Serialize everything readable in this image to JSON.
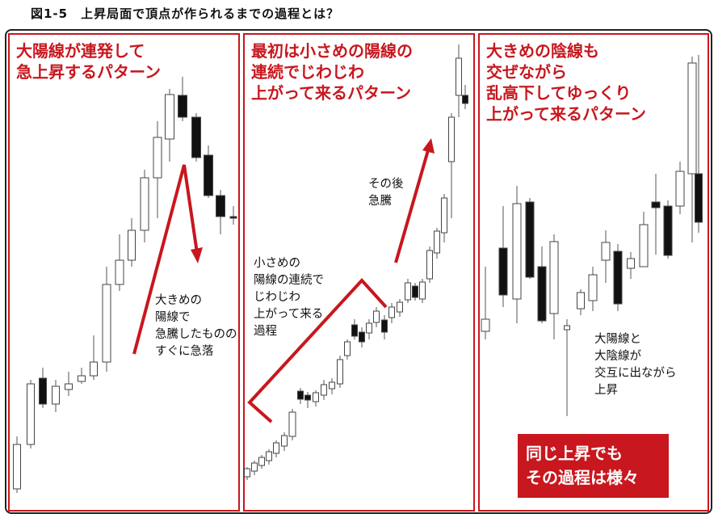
{
  "figure_title": "図1-5　上昇局面で頂点が作られるまでの過程とは？",
  "panels": [
    {
      "title_lines": [
        "大陽線が連発して",
        "急上昇するパターン"
      ],
      "note_lines": [
        "大きめの",
        "陽線で",
        "急騰したものの",
        "すぐに急落"
      ]
    },
    {
      "title_lines": [
        "最初は小さめの陽線の",
        "連続でじわじわ",
        "上がって来るパターン"
      ],
      "note_lines": [
        "小さめの",
        "陽線の連続で",
        "じわじわ",
        "上がって来る",
        "過程"
      ],
      "note2_lines": [
        "その後",
        "急騰"
      ]
    },
    {
      "title_lines": [
        "大きめの陰線も",
        "交ぜながら",
        "乱高下してゆっくり",
        "上がって来るパターン"
      ],
      "note_lines": [
        "大陽線と",
        "大陰線が",
        "交互に出ながら",
        "上昇"
      ]
    }
  ],
  "callout_lines": [
    "同じ上昇でも",
    "その過程は様々"
  ],
  "colors": {
    "accent": "#c8171e",
    "bullish": "#ffffff",
    "bearish": "#111111",
    "frame": "#222222"
  }
}
